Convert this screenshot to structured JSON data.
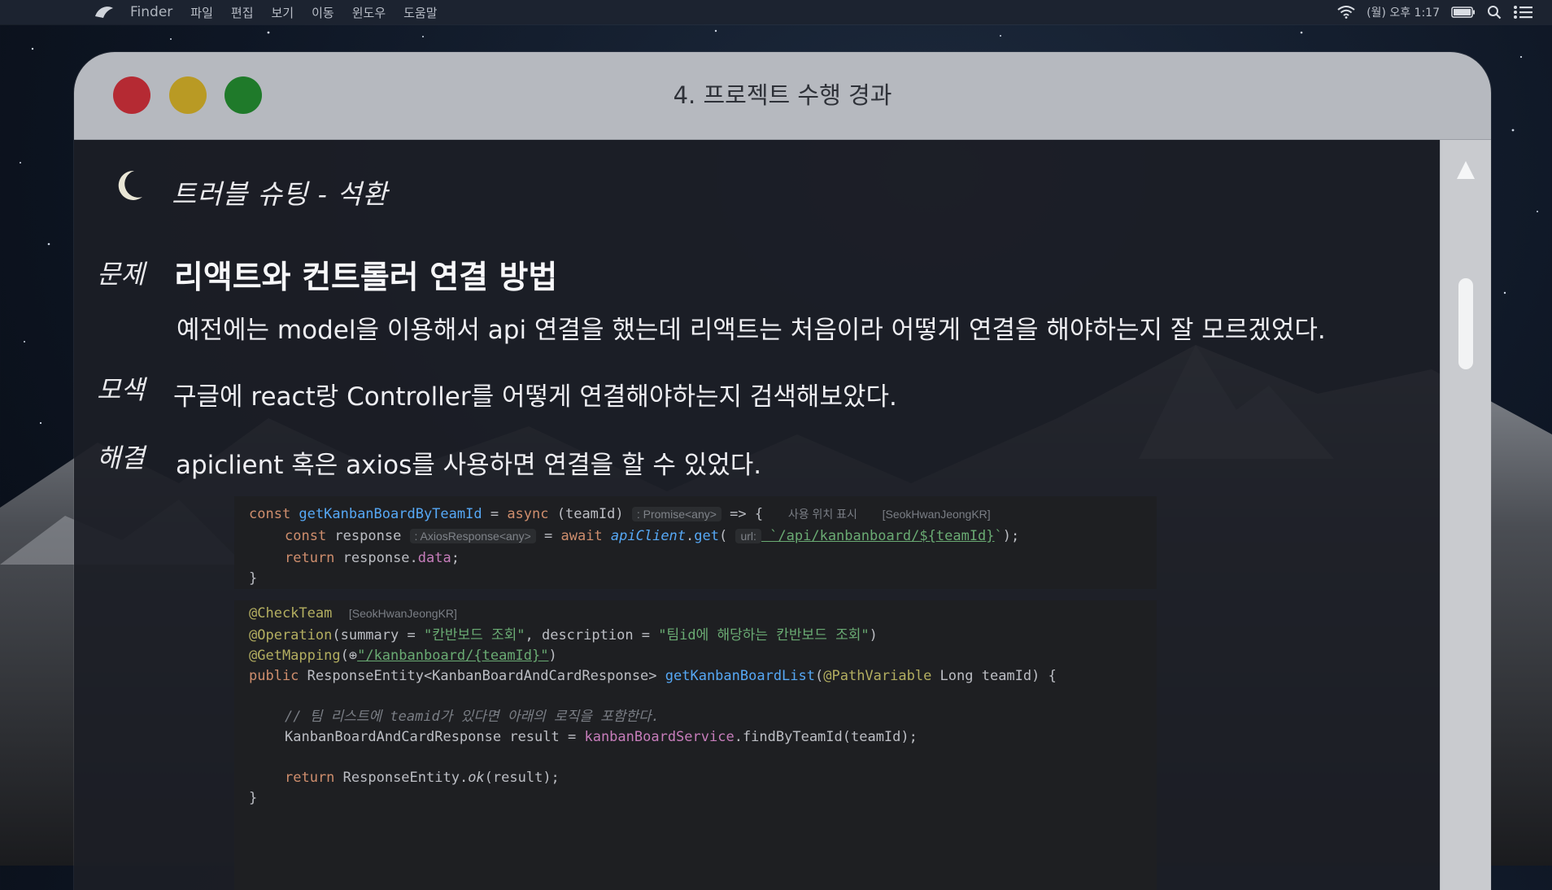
{
  "menubar": {
    "app_name": "Finder",
    "menus": [
      "파일",
      "편집",
      "보기",
      "이동",
      "윈도우",
      "도움말"
    ],
    "clock": "(월) 오후 1:17"
  },
  "window": {
    "title": "4. 프로젝트 수행 경과"
  },
  "section": {
    "label": "트러블 슈팅 - 석환"
  },
  "problem": {
    "tag": "문제",
    "title": "리액트와 컨트롤러 연결 방법",
    "description": "예전에는 model을 이용해서 api 연결을 했는데 리액트는 처음이라 어떻게 연결을 해야하는지 잘 모르겠었다."
  },
  "search": {
    "tag": "모색",
    "text": "구글에 react랑 Controller를 어떻게 연결해야하는지 검색해보았다."
  },
  "solution": {
    "tag": "해결",
    "text": "apiclient 혹은 axios를 사용하면 연결을 할 수 있었다."
  },
  "code1": {
    "l1_const": "const ",
    "l1_name": "getKanbanBoardByTeamId",
    "l1_eq": " = ",
    "l1_async": "async",
    "l1_param": " (teamId) ",
    "l1_hint": ": Promise<any>",
    "l1_arrow": " => {",
    "l1_usage": "사용 위치 표시",
    "l1_author": "[SeokHwanJeongKR]",
    "l2_const": "const ",
    "l2_var": "response ",
    "l2_hint": ": AxiosResponse<any>",
    "l2_eq": " = ",
    "l2_await": "await ",
    "l2_client": "apiClient",
    "l2_dot": ".",
    "l2_get": "get",
    "l2_open": "( ",
    "l2_url_hint": "url:",
    "l2_str1": " `/api/kanbanboard/",
    "l2_tpl": "${teamId}",
    "l2_str2": "`",
    "l2_close": ");",
    "l3_return": "return ",
    "l3_var": "response.",
    "l3_prop": "data",
    "l3_end": ";",
    "l4": "}"
  },
  "code2": {
    "l1_ann": "@CheckTeam",
    "l1_author": "[SeokHwanJeongKR]",
    "l2_ann": "@Operation",
    "l2_a": "(summary = ",
    "l2_s1": "\"칸반보드 조회\"",
    "l2_b": ", description = ",
    "l2_s2": "\"팀id에 해당하는 칸반보드 조회\"",
    "l2_c": ")",
    "l3_ann": "@GetMapping",
    "l3_a": "(",
    "l3_globe": "⊕",
    "l3_s": "\"/kanbanboard/{teamId}\"",
    "l3_b": ")",
    "l4_public": "public ",
    "l4_type": "ResponseEntity<KanbanBoardAndCardResponse> ",
    "l4_fn": "getKanbanBoardList",
    "l4_a": "(",
    "l4_ann": "@PathVariable",
    "l4_b": " Long teamId) {",
    "l6_cmt": "// 팀 리스트에 teamid가 있다면 아래의 로직을 포함한다.",
    "l7_a": "KanbanBoardAndCardResponse result = ",
    "l7_svc": "kanbanBoardService",
    "l7_b": ".findByTeamId(teamId);",
    "l9_return": "return ",
    "l9_a": "ResponseEntity.",
    "l9_ok": "ok",
    "l9_b": "(result);",
    "l10": "}"
  },
  "colors": {
    "red_dot": "#b52a33",
    "yellow_dot": "#b99a24",
    "green_dot": "#1f7a2a",
    "titlebar": "#b6b9bf"
  }
}
